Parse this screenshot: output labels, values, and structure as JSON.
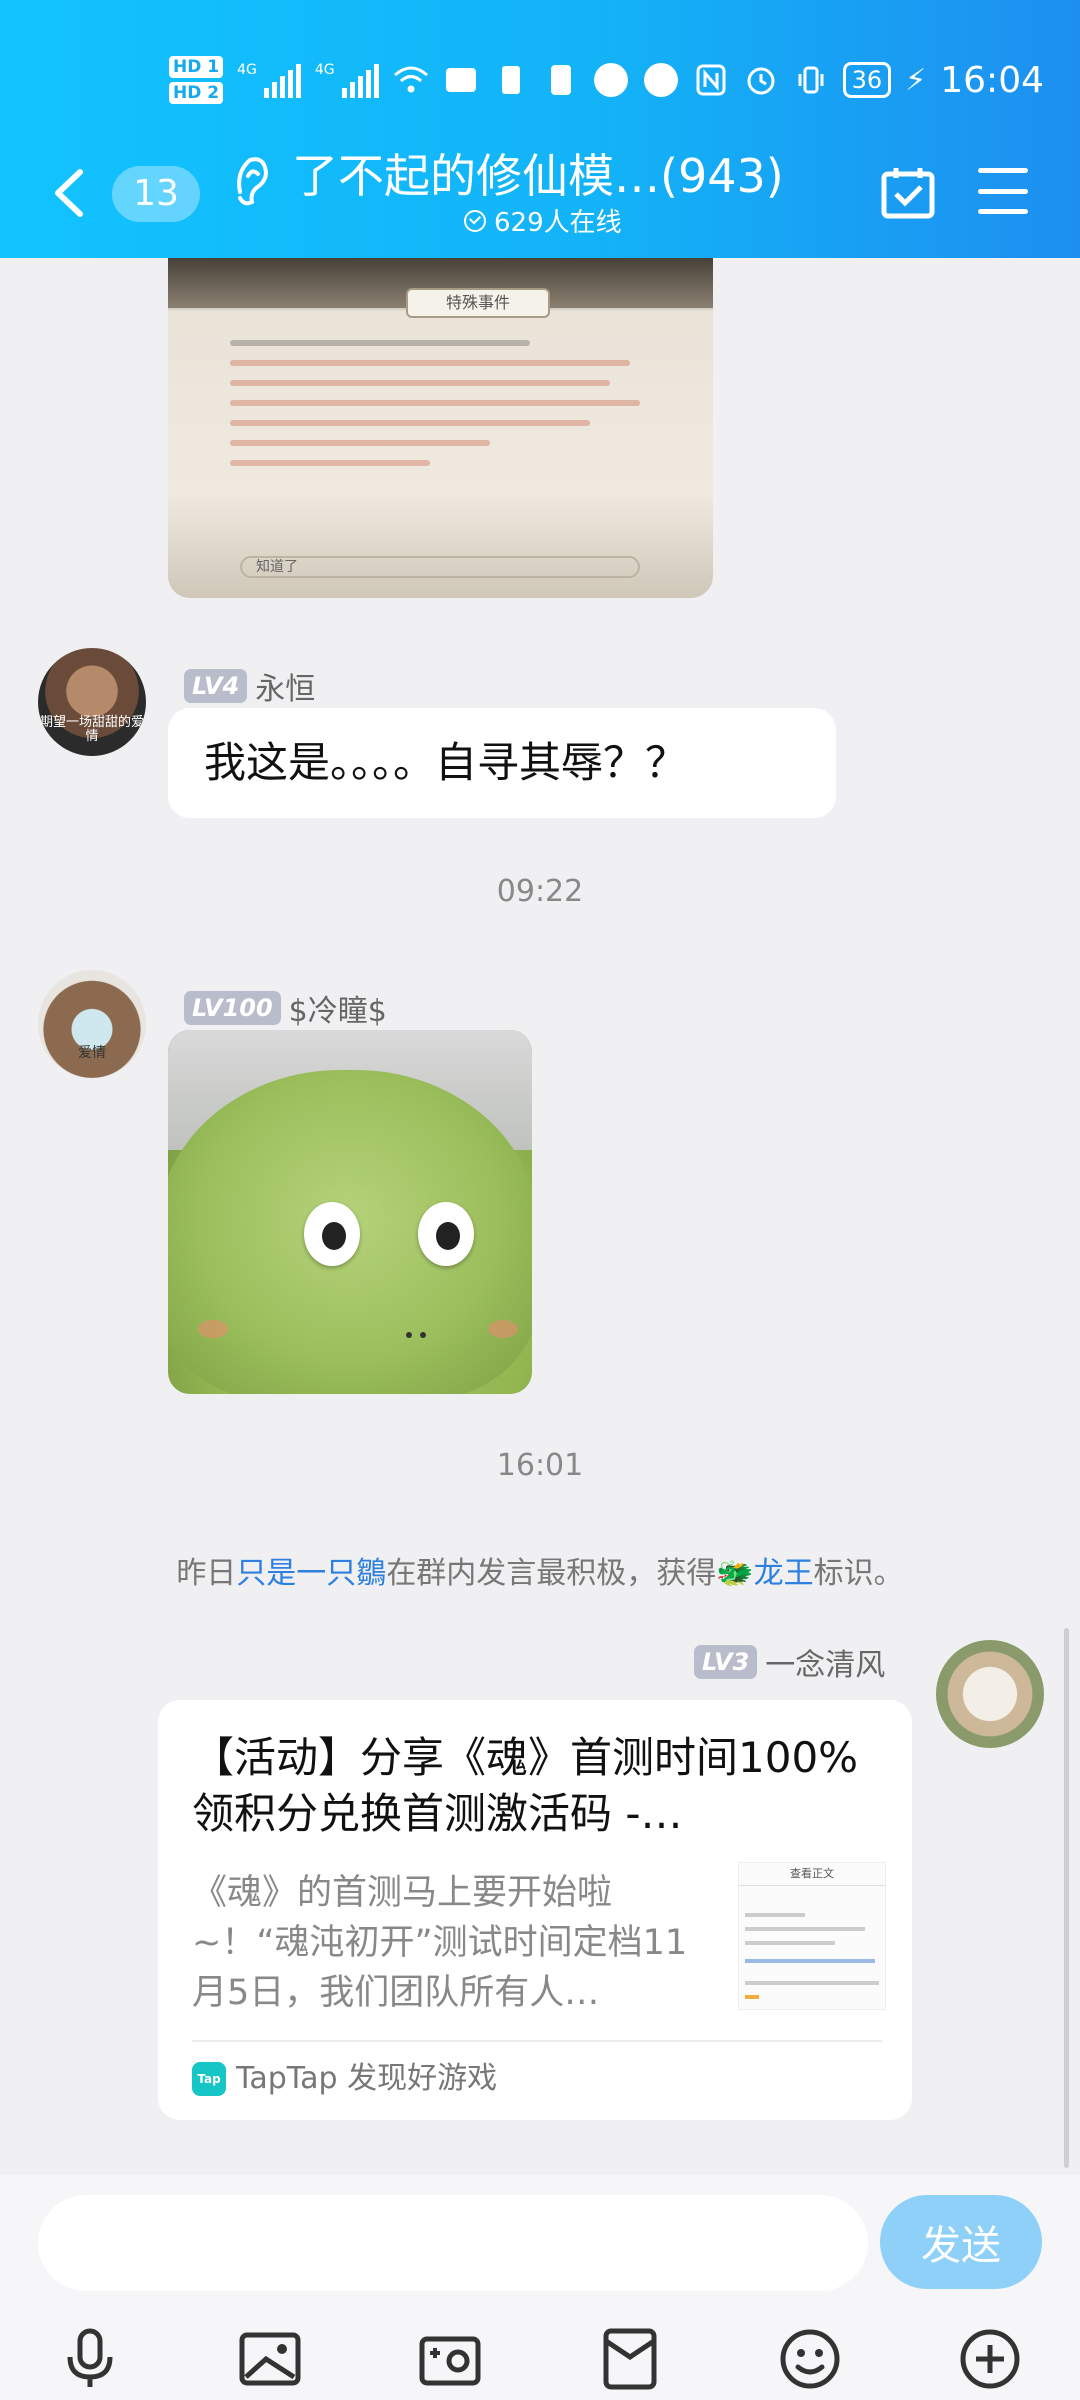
{
  "status_bar": {
    "hd1": "HD 1",
    "hd2": "HD 2",
    "net1": "4G",
    "net2": "4G",
    "battery": "36",
    "time": "16:04"
  },
  "header": {
    "unread_count": "13",
    "title": "了不起的修仙模…(943)",
    "online": "629人在线"
  },
  "photo": {
    "dialog_title": "特殊事件",
    "button_text": "知道了"
  },
  "messages": {
    "m1": {
      "level": "LV4",
      "sender": "永恒",
      "text": "我这是。。。。自寻其辱？？",
      "avatar_caption": "期望一场甜甜的爱情"
    },
    "time1": "09:22",
    "m2": {
      "level": "LV100",
      "sender": "$冷瞳$",
      "avatar_caption": "爱情"
    },
    "time2": "16:01",
    "system": {
      "prefix": "昨日",
      "user": "只是一只鶵",
      "middle": "在群内发言最积极，获得",
      "title_icon": "🐲",
      "title": "龙王",
      "suffix": "标识。"
    },
    "m3": {
      "level": "LV3",
      "sender": "一念清风",
      "card": {
        "title": "【活动】分享《魂》首测时间100%领积分兑换首测激活码 -…",
        "desc": "《魂》的首测马上要开始啦~！“魂沌初开”测试时间定档11月5日，我们团队所有人…",
        "thumb_title": "查看正文",
        "source_logo": "Tap",
        "source": "TapTap 发现好游戏"
      }
    }
  },
  "composer": {
    "placeholder": "",
    "send_label": "发送"
  },
  "toolbar": [
    "microphone-icon",
    "image-icon",
    "camera-icon",
    "red-packet-icon",
    "emoji-icon",
    "plus-icon"
  ],
  "colors": {
    "header_start": "#12c3ff",
    "header_end": "#1d8ff0",
    "link": "#2d7fe0",
    "send_button": "#8fd0f8",
    "level_badge": "#b8bccb"
  }
}
